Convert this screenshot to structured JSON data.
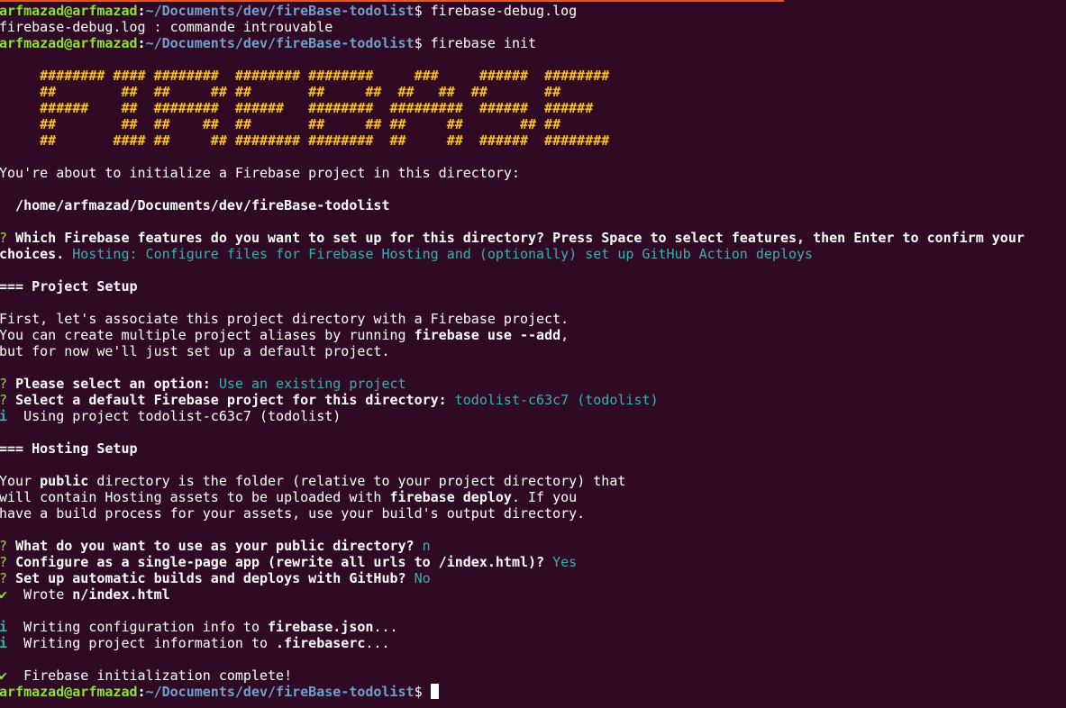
{
  "terminal": {
    "colors": {
      "background": "#300a24",
      "prompt_user": "#8ae234",
      "prompt_path": "#729fcf",
      "answer": "#34b1b1",
      "banner": "#fcc11b",
      "text": "#ffffff"
    },
    "lines": [
      [
        {
          "t": "arfmazad@arfmazad",
          "c": "green b"
        },
        {
          "t": ":",
          "c": "b"
        },
        {
          "t": "~/Documents/dev/fireBase-todolist",
          "c": "blue b"
        },
        {
          "t": "$ firebase-debug.log"
        }
      ],
      [
        {
          "t": "firebase-debug.log : commande introuvable"
        }
      ],
      [
        {
          "t": "arfmazad@arfmazad",
          "c": "green b"
        },
        {
          "t": ":",
          "c": "b"
        },
        {
          "t": "~/Documents/dev/fireBase-todolist",
          "c": "blue b"
        },
        {
          "t": "$ firebase init"
        }
      ],
      [],
      [
        {
          "t": "     ######## #### ########  ######## ########     ###     ######  ########",
          "c": "yellow b"
        }
      ],
      [
        {
          "t": "     ##        ##  ##     ## ##       ##     ##  ##   ##  ##       ##",
          "c": "yellow b"
        }
      ],
      [
        {
          "t": "     ######    ##  ########  ######   ########  #########  ######  ######",
          "c": "yellow b"
        }
      ],
      [
        {
          "t": "     ##        ##  ##    ##  ##       ##     ## ##     ##       ## ##",
          "c": "yellow b"
        }
      ],
      [
        {
          "t": "     ##       #### ##     ## ######## ########  ##     ##  ######  ########",
          "c": "yellow b"
        }
      ],
      [],
      [
        {
          "t": "You're about to initialize a Firebase project in this directory:"
        }
      ],
      [],
      [
        {
          "t": "  /home/arfmazad/Documents/dev/fireBase-todolist",
          "c": "b"
        }
      ],
      [],
      [
        {
          "t": "? ",
          "c": "green"
        },
        {
          "t": "Which Firebase features do you want to set up for this directory? Press Space to select features, then Enter to confirm your",
          "c": "b"
        }
      ],
      [
        {
          "t": "choices. ",
          "c": "b"
        },
        {
          "t": "Hosting: Configure files for Firebase Hosting and (optionally) set up GitHub Action deploys",
          "c": "cyan"
        }
      ],
      [],
      [
        {
          "t": "=== Project Setup",
          "c": "b"
        }
      ],
      [],
      [
        {
          "t": "First, let's associate this project directory with a Firebase project."
        }
      ],
      [
        {
          "t": "You can create multiple project aliases by running "
        },
        {
          "t": "firebase use --add",
          "c": "b"
        },
        {
          "t": ","
        }
      ],
      [
        {
          "t": "but for now we'll just set up a default project."
        }
      ],
      [],
      [
        {
          "t": "? ",
          "c": "green"
        },
        {
          "t": "Please select an option: ",
          "c": "b"
        },
        {
          "t": "Use an existing project",
          "c": "cyan"
        }
      ],
      [
        {
          "t": "? ",
          "c": "green"
        },
        {
          "t": "Select a default Firebase project for this directory: ",
          "c": "b"
        },
        {
          "t": "todolist-c63c7 (todolist)",
          "c": "cyan"
        }
      ],
      [
        {
          "t": "i ",
          "c": "cyan b"
        },
        {
          "t": " Using project todolist-c63c7 (todolist)"
        }
      ],
      [],
      [
        {
          "t": "=== Hosting Setup",
          "c": "b"
        }
      ],
      [],
      [
        {
          "t": "Your "
        },
        {
          "t": "public",
          "c": "b"
        },
        {
          "t": " directory is the folder (relative to your project directory) that"
        }
      ],
      [
        {
          "t": "will contain Hosting assets to be uploaded with "
        },
        {
          "t": "firebase deploy",
          "c": "b"
        },
        {
          "t": ". If you"
        }
      ],
      [
        {
          "t": "have a build process for your assets, use your build's output directory."
        }
      ],
      [],
      [
        {
          "t": "? ",
          "c": "green"
        },
        {
          "t": "What do you want to use as your public directory? ",
          "c": "b"
        },
        {
          "t": "n",
          "c": "cyan"
        }
      ],
      [
        {
          "t": "? ",
          "c": "green"
        },
        {
          "t": "Configure as a single-page app (rewrite all urls to /index.html)? ",
          "c": "b"
        },
        {
          "t": "Yes",
          "c": "cyan"
        }
      ],
      [
        {
          "t": "? ",
          "c": "green"
        },
        {
          "t": "Set up automatic builds and deploys with GitHub? ",
          "c": "b"
        },
        {
          "t": "No",
          "c": "cyan"
        }
      ],
      [
        {
          "t": "✔ ",
          "c": "green b"
        },
        {
          "t": " Wrote "
        },
        {
          "t": "n/index.html",
          "c": "b"
        }
      ],
      [],
      [
        {
          "t": "i ",
          "c": "cyan b"
        },
        {
          "t": " Writing configuration info to "
        },
        {
          "t": "firebase.json",
          "c": "b"
        },
        {
          "t": "..."
        }
      ],
      [
        {
          "t": "i ",
          "c": "cyan b"
        },
        {
          "t": " Writing project information to "
        },
        {
          "t": ".firebaserc",
          "c": "b"
        },
        {
          "t": "..."
        }
      ],
      [],
      [
        {
          "t": "✔ ",
          "c": "green b"
        },
        {
          "t": " Firebase initialization complete!"
        }
      ],
      [
        {
          "t": "arfmazad@arfmazad",
          "c": "green b"
        },
        {
          "t": ":",
          "c": "b"
        },
        {
          "t": "~/Documents/dev/fireBase-todolist",
          "c": "blue b"
        },
        {
          "t": "$ "
        },
        {
          "cursor": true
        }
      ]
    ]
  }
}
